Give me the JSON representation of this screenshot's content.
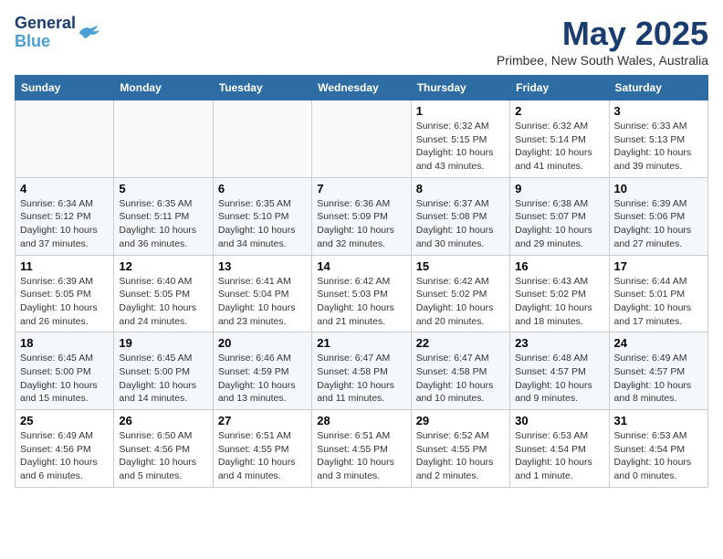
{
  "logo": {
    "line1": "General",
    "line2": "Blue"
  },
  "title": "May 2025",
  "location": "Primbee, New South Wales, Australia",
  "days_of_week": [
    "Sunday",
    "Monday",
    "Tuesday",
    "Wednesday",
    "Thursday",
    "Friday",
    "Saturday"
  ],
  "weeks": [
    [
      {
        "day": "",
        "info": ""
      },
      {
        "day": "",
        "info": ""
      },
      {
        "day": "",
        "info": ""
      },
      {
        "day": "",
        "info": ""
      },
      {
        "day": "1",
        "info": "Sunrise: 6:32 AM\nSunset: 5:15 PM\nDaylight: 10 hours\nand 43 minutes."
      },
      {
        "day": "2",
        "info": "Sunrise: 6:32 AM\nSunset: 5:14 PM\nDaylight: 10 hours\nand 41 minutes."
      },
      {
        "day": "3",
        "info": "Sunrise: 6:33 AM\nSunset: 5:13 PM\nDaylight: 10 hours\nand 39 minutes."
      }
    ],
    [
      {
        "day": "4",
        "info": "Sunrise: 6:34 AM\nSunset: 5:12 PM\nDaylight: 10 hours\nand 37 minutes."
      },
      {
        "day": "5",
        "info": "Sunrise: 6:35 AM\nSunset: 5:11 PM\nDaylight: 10 hours\nand 36 minutes."
      },
      {
        "day": "6",
        "info": "Sunrise: 6:35 AM\nSunset: 5:10 PM\nDaylight: 10 hours\nand 34 minutes."
      },
      {
        "day": "7",
        "info": "Sunrise: 6:36 AM\nSunset: 5:09 PM\nDaylight: 10 hours\nand 32 minutes."
      },
      {
        "day": "8",
        "info": "Sunrise: 6:37 AM\nSunset: 5:08 PM\nDaylight: 10 hours\nand 30 minutes."
      },
      {
        "day": "9",
        "info": "Sunrise: 6:38 AM\nSunset: 5:07 PM\nDaylight: 10 hours\nand 29 minutes."
      },
      {
        "day": "10",
        "info": "Sunrise: 6:39 AM\nSunset: 5:06 PM\nDaylight: 10 hours\nand 27 minutes."
      }
    ],
    [
      {
        "day": "11",
        "info": "Sunrise: 6:39 AM\nSunset: 5:05 PM\nDaylight: 10 hours\nand 26 minutes."
      },
      {
        "day": "12",
        "info": "Sunrise: 6:40 AM\nSunset: 5:05 PM\nDaylight: 10 hours\nand 24 minutes."
      },
      {
        "day": "13",
        "info": "Sunrise: 6:41 AM\nSunset: 5:04 PM\nDaylight: 10 hours\nand 23 minutes."
      },
      {
        "day": "14",
        "info": "Sunrise: 6:42 AM\nSunset: 5:03 PM\nDaylight: 10 hours\nand 21 minutes."
      },
      {
        "day": "15",
        "info": "Sunrise: 6:42 AM\nSunset: 5:02 PM\nDaylight: 10 hours\nand 20 minutes."
      },
      {
        "day": "16",
        "info": "Sunrise: 6:43 AM\nSunset: 5:02 PM\nDaylight: 10 hours\nand 18 minutes."
      },
      {
        "day": "17",
        "info": "Sunrise: 6:44 AM\nSunset: 5:01 PM\nDaylight: 10 hours\nand 17 minutes."
      }
    ],
    [
      {
        "day": "18",
        "info": "Sunrise: 6:45 AM\nSunset: 5:00 PM\nDaylight: 10 hours\nand 15 minutes."
      },
      {
        "day": "19",
        "info": "Sunrise: 6:45 AM\nSunset: 5:00 PM\nDaylight: 10 hours\nand 14 minutes."
      },
      {
        "day": "20",
        "info": "Sunrise: 6:46 AM\nSunset: 4:59 PM\nDaylight: 10 hours\nand 13 minutes."
      },
      {
        "day": "21",
        "info": "Sunrise: 6:47 AM\nSunset: 4:58 PM\nDaylight: 10 hours\nand 11 minutes."
      },
      {
        "day": "22",
        "info": "Sunrise: 6:47 AM\nSunset: 4:58 PM\nDaylight: 10 hours\nand 10 minutes."
      },
      {
        "day": "23",
        "info": "Sunrise: 6:48 AM\nSunset: 4:57 PM\nDaylight: 10 hours\nand 9 minutes."
      },
      {
        "day": "24",
        "info": "Sunrise: 6:49 AM\nSunset: 4:57 PM\nDaylight: 10 hours\nand 8 minutes."
      }
    ],
    [
      {
        "day": "25",
        "info": "Sunrise: 6:49 AM\nSunset: 4:56 PM\nDaylight: 10 hours\nand 6 minutes."
      },
      {
        "day": "26",
        "info": "Sunrise: 6:50 AM\nSunset: 4:56 PM\nDaylight: 10 hours\nand 5 minutes."
      },
      {
        "day": "27",
        "info": "Sunrise: 6:51 AM\nSunset: 4:55 PM\nDaylight: 10 hours\nand 4 minutes."
      },
      {
        "day": "28",
        "info": "Sunrise: 6:51 AM\nSunset: 4:55 PM\nDaylight: 10 hours\nand 3 minutes."
      },
      {
        "day": "29",
        "info": "Sunrise: 6:52 AM\nSunset: 4:55 PM\nDaylight: 10 hours\nand 2 minutes."
      },
      {
        "day": "30",
        "info": "Sunrise: 6:53 AM\nSunset: 4:54 PM\nDaylight: 10 hours\nand 1 minute."
      },
      {
        "day": "31",
        "info": "Sunrise: 6:53 AM\nSunset: 4:54 PM\nDaylight: 10 hours\nand 0 minutes."
      }
    ]
  ]
}
